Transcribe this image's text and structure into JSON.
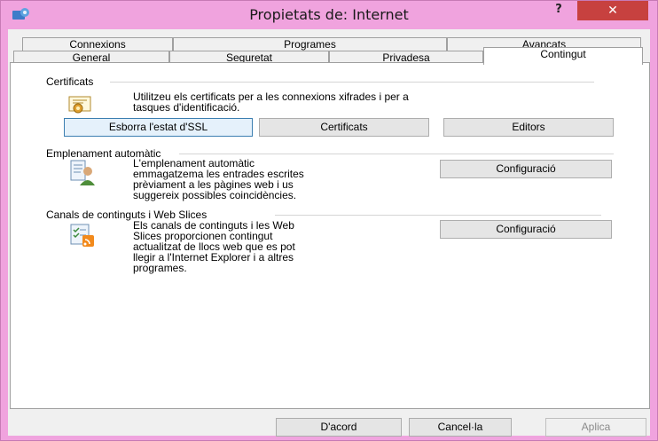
{
  "window": {
    "title": "Propietats de: Internet",
    "help_label": "?",
    "close_label": "✕"
  },
  "tabs": {
    "row1": [
      "Connexions",
      "Programes",
      "Avançats"
    ],
    "row2": [
      "General",
      "Seguretat",
      "Privadesa",
      "Contingut"
    ],
    "active": "Contingut"
  },
  "certificates": {
    "heading": "Certificats",
    "description_line1": "Utilitzeu els certificats per a les connexions xifrades i per a",
    "description_line2": "tasques d'identificació.",
    "clear_ssl_label": "Esborra l'estat d'SSL",
    "certificates_label": "Certificats",
    "publishers_label": "Editors"
  },
  "autocomplete": {
    "heading": "Emplenament automàtic",
    "line1": "L'emplenament automàtic",
    "line2": "emmagatzema les entrades escrites",
    "line3": "prèviament a les pàgines web i us",
    "line4": "suggereix possibles coincidències.",
    "settings_label": "Configuració"
  },
  "feeds": {
    "heading": "Canals de continguts i Web Slices",
    "line1": "Els canals de continguts i les Web",
    "line2": "Slices proporcionen contingut",
    "line3": "actualitzat de llocs web que es pot",
    "line4": "llegir a l'Internet Explorer i a altres",
    "line5": "programes.",
    "settings_label": "Configuració"
  },
  "footer": {
    "ok_label": "D'acord",
    "cancel_label": "Cancel·la",
    "apply_label": "Aplica"
  },
  "colors": {
    "title_bar": "#f0a3de",
    "close_button": "#c7413f",
    "focus_border": "#3c7fb1"
  }
}
